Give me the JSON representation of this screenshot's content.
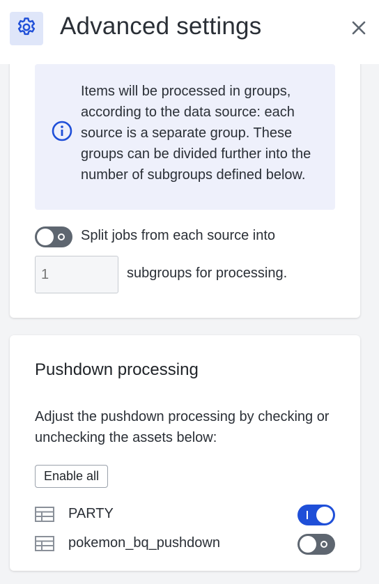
{
  "header": {
    "title": "Advanced settings",
    "settings_icon": "gear-icon",
    "close_icon": "close-icon"
  },
  "grouping": {
    "info_icon": "info-icon",
    "info_text": "Items will be processed in groups, according to the data source: each source is a separate group. These groups can be divided further into the number of subgroups defined below.",
    "split_toggle_on": false,
    "split_label": "Split jobs from each source into",
    "subgroup_placeholder": "1",
    "subgroup_label": "subgroups for processing."
  },
  "pushdown": {
    "title": "Pushdown processing",
    "description": "Adjust the pushdown processing by checking or unchecking the assets below:",
    "enable_all_label": "Enable all",
    "assets": [
      {
        "name": "PARTY",
        "icon": "table-icon",
        "enabled": true
      },
      {
        "name": "pokemon_bq_pushdown",
        "icon": "table-icon",
        "enabled": false
      }
    ]
  },
  "colors": {
    "accent": "#1f4fd8",
    "info_background": "#eef0fb",
    "gear_background": "#dfe6f9",
    "toggle_off": "#5e6670"
  }
}
